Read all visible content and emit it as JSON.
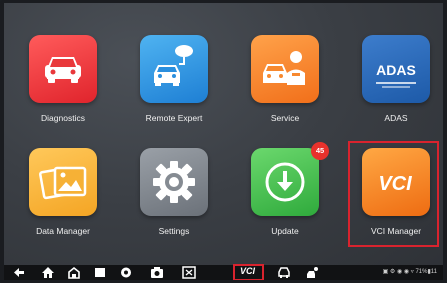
{
  "apps": [
    {
      "label": "Diagnostics"
    },
    {
      "label": "Remote Expert"
    },
    {
      "label": "Service"
    },
    {
      "label": "ADAS",
      "icon_text": "ADAS"
    },
    {
      "label": "Data Manager"
    },
    {
      "label": "Settings"
    },
    {
      "label": "Update",
      "badge": "45"
    },
    {
      "label": "VCI Manager",
      "icon_text": "VCI"
    }
  ],
  "navbar": {
    "vci_text": "VCI",
    "status_text": "▣ ⚙ ◉ ◉ ▿ 71%▮11"
  },
  "colors": {
    "highlight": "#d9232e",
    "badge": "#e8322c"
  }
}
